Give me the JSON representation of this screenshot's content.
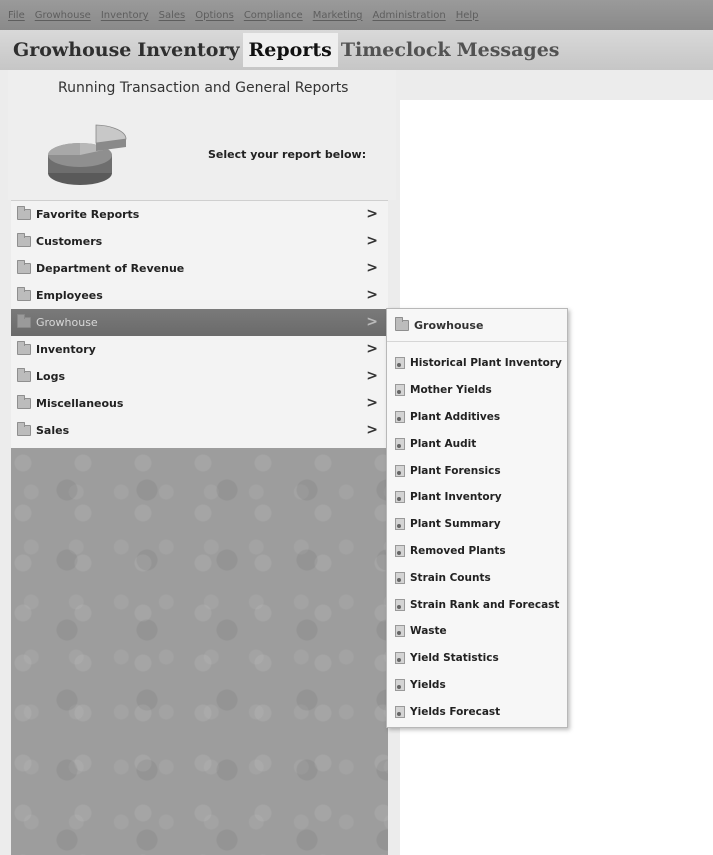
{
  "menu": [
    "File",
    "Growhouse",
    "Inventory",
    "Sales",
    "Options",
    "Compliance",
    "Marketing",
    "Administration",
    "Help"
  ],
  "tabs": [
    "Growhouse",
    "Inventory",
    "Reports",
    "Timeclock",
    "Messages"
  ],
  "active_tab": "Reports",
  "panel": {
    "title": "Running Transaction and General Reports",
    "select_label": "Select your report below:",
    "icon": "pie-chart-icon"
  },
  "report_categories": [
    "Favorite Reports",
    "Customers",
    "Department of Revenue",
    "Employees",
    "Growhouse",
    "Inventory",
    "Logs",
    "Miscellaneous",
    "Sales"
  ],
  "selected_category": "Growhouse",
  "chevron": ">",
  "submenu": {
    "header": "Growhouse",
    "items": [
      "Historical Plant Inventory",
      "Mother Yields",
      "Plant Additives",
      "Plant Audit",
      "Plant Forensics",
      "Plant Inventory",
      "Plant Summary",
      "Removed Plants",
      "Strain Counts",
      "Strain Rank and Forecast",
      "Waste",
      "Yield Statistics",
      "Yields",
      "Yields Forecast"
    ]
  }
}
